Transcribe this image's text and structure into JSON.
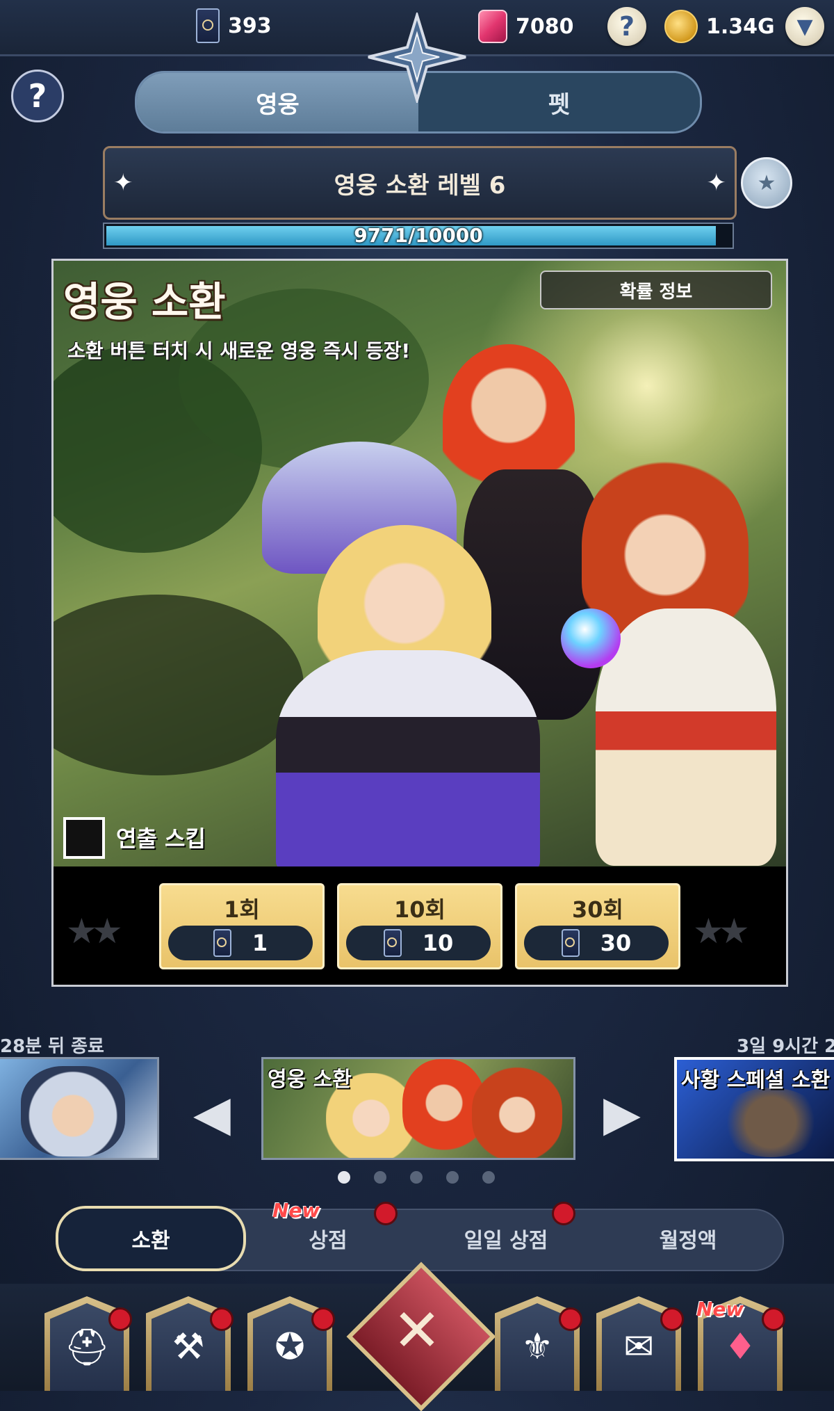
{
  "top_bar": {
    "summon_tickets": "393",
    "gems": "7080",
    "gold": "1.34G",
    "help_icon": "question-icon",
    "menu_icon": "chevron-down-icon"
  },
  "tabs": [
    {
      "label": "영웅",
      "active": true
    },
    {
      "label": "펫",
      "active": false
    }
  ],
  "summon_level": {
    "title": "영웅 소환 레벨 6",
    "progress_text": "9771/10000",
    "progress_fraction": 0.9771
  },
  "panel": {
    "title": "영웅 소환",
    "subtitle": "소환 버튼 터치 시 새로운 영웅 즉시 등장!",
    "probability_button": "확률 정보",
    "skip_label": "연출 스킵"
  },
  "summon_buttons": [
    {
      "label": "1회",
      "cost": "1"
    },
    {
      "label": "10회",
      "cost": "10"
    },
    {
      "label": "30회",
      "cost": "30"
    }
  ],
  "carousel": {
    "left_timer": "28분 뒤 종료",
    "right_timer": "3일 9시간 2",
    "center_title": "영웅 소환",
    "right_title": "사황 스페셜 소환",
    "dots": 5,
    "active_dot": 0
  },
  "nav_tabs": [
    {
      "label": "소환",
      "active": true,
      "badge": false,
      "new": false
    },
    {
      "label": "상점",
      "active": false,
      "badge": true,
      "new": true
    },
    {
      "label": "일일 상점",
      "active": false,
      "badge": true,
      "new": false
    },
    {
      "label": "월정액",
      "active": false,
      "badge": false,
      "new": false
    }
  ],
  "new_label": "New",
  "colors": {
    "accent_gold": "#e9c36a",
    "progress": "#2f98c5",
    "badge_red": "#d21a2b"
  },
  "bottom_menu": [
    {
      "icon": "hero-helmet-icon",
      "badge": true
    },
    {
      "icon": "equipment-icon",
      "badge": true
    },
    {
      "icon": "spellbook-icon",
      "badge": true
    },
    {
      "icon": "close-icon",
      "badge": false
    },
    {
      "icon": "guild-shield-icon",
      "badge": true
    },
    {
      "icon": "quest-scroll-icon",
      "badge": true
    },
    {
      "icon": "treasure-chest-icon",
      "badge": true,
      "new": true
    }
  ]
}
